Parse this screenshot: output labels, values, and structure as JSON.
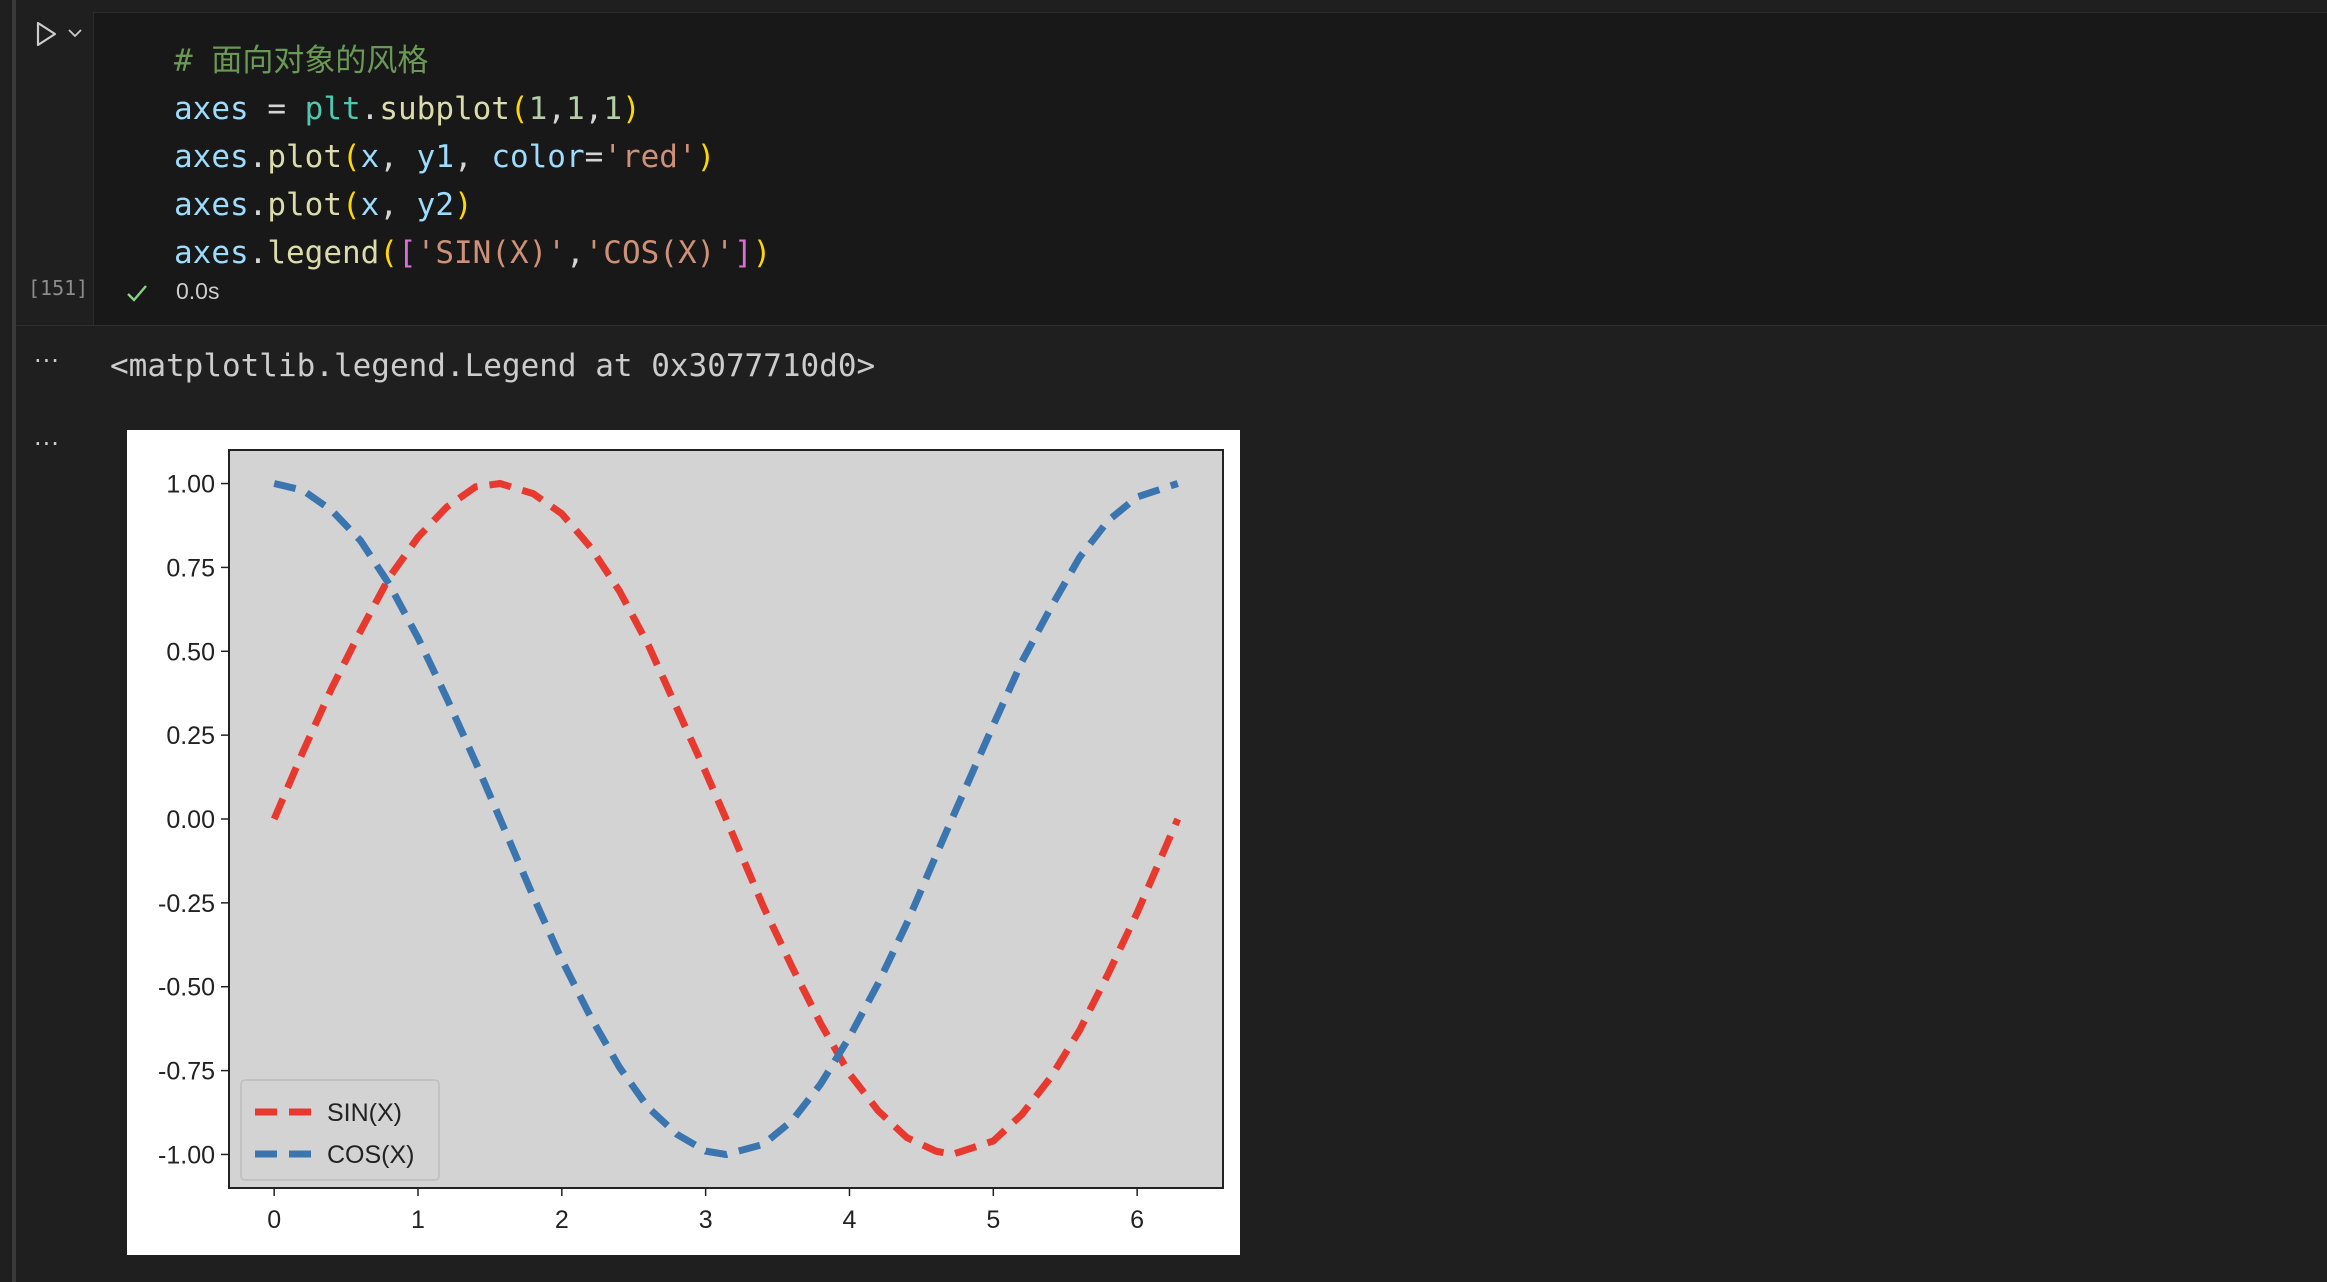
{
  "cell": {
    "execution_count": "[151]",
    "status_time": "0.0s",
    "code_lines": [
      [
        {
          "t": "# 面向对象的风格",
          "c": "comment"
        }
      ],
      [
        {
          "t": "axes",
          "c": "var"
        },
        {
          "t": " = ",
          "c": "plain"
        },
        {
          "t": "plt",
          "c": "module"
        },
        {
          "t": ".",
          "c": "plain"
        },
        {
          "t": "subplot",
          "c": "func"
        },
        {
          "t": "(",
          "c": "paren1"
        },
        {
          "t": "1",
          "c": "num"
        },
        {
          "t": ",",
          "c": "plain"
        },
        {
          "t": "1",
          "c": "num"
        },
        {
          "t": ",",
          "c": "plain"
        },
        {
          "t": "1",
          "c": "num"
        },
        {
          "t": ")",
          "c": "paren1"
        }
      ],
      [
        {
          "t": "axes",
          "c": "var"
        },
        {
          "t": ".",
          "c": "plain"
        },
        {
          "t": "plot",
          "c": "func"
        },
        {
          "t": "(",
          "c": "paren1"
        },
        {
          "t": "x",
          "c": "var"
        },
        {
          "t": ", ",
          "c": "plain"
        },
        {
          "t": "y1",
          "c": "var"
        },
        {
          "t": ", ",
          "c": "plain"
        },
        {
          "t": "color",
          "c": "var"
        },
        {
          "t": "=",
          "c": "plain"
        },
        {
          "t": "'red'",
          "c": "str"
        },
        {
          "t": ")",
          "c": "paren1"
        }
      ],
      [
        {
          "t": "axes",
          "c": "var"
        },
        {
          "t": ".",
          "c": "plain"
        },
        {
          "t": "plot",
          "c": "func"
        },
        {
          "t": "(",
          "c": "paren1"
        },
        {
          "t": "x",
          "c": "var"
        },
        {
          "t": ", ",
          "c": "plain"
        },
        {
          "t": "y2",
          "c": "var"
        },
        {
          "t": ")",
          "c": "paren1"
        }
      ],
      [
        {
          "t": "axes",
          "c": "var"
        },
        {
          "t": ".",
          "c": "plain"
        },
        {
          "t": "legend",
          "c": "func"
        },
        {
          "t": "(",
          "c": "paren1"
        },
        {
          "t": "[",
          "c": "paren2"
        },
        {
          "t": "'SIN(X)'",
          "c": "str"
        },
        {
          "t": ",",
          "c": "plain"
        },
        {
          "t": "'COS(X)'",
          "c": "str"
        },
        {
          "t": "]",
          "c": "paren2"
        },
        {
          "t": ")",
          "c": "paren1"
        }
      ]
    ]
  },
  "output": {
    "gutter_1": "···",
    "gutter_2": "···",
    "text": "<matplotlib.legend.Legend at 0x3077710d0>"
  },
  "colors": {
    "sin": "#e8392f",
    "cos": "#3b75af",
    "axes_bg": "#d3d3d3"
  },
  "chart_data": {
    "type": "line",
    "title": "",
    "xlabel": "",
    "ylabel": "",
    "xlim": [
      -0.314,
      6.597
    ],
    "ylim": [
      -1.1,
      1.1
    ],
    "x_ticks": [
      0,
      1,
      2,
      3,
      4,
      5,
      6
    ],
    "x_tick_labels": [
      "0",
      "1",
      "2",
      "3",
      "4",
      "5",
      "6"
    ],
    "y_ticks": [
      1.0,
      0.75,
      0.5,
      0.25,
      0.0,
      -0.25,
      -0.5,
      -0.75,
      -1.0
    ],
    "y_tick_labels": [
      "1.00",
      "0.75",
      "0.50",
      "0.25",
      "0.00",
      "-0.25",
      "-0.50",
      "-0.75",
      "-1.00"
    ],
    "grid": false,
    "legend_position": "lower-left",
    "line_style": "dashed",
    "series": [
      {
        "name": "SIN(X)",
        "color": "#e8392f",
        "x": [
          0,
          0.2,
          0.4,
          0.6,
          0.8,
          1.0,
          1.2,
          1.4,
          1.571,
          1.8,
          2.0,
          2.2,
          2.4,
          2.6,
          2.8,
          3.0,
          3.142,
          3.4,
          3.6,
          3.8,
          4.0,
          4.2,
          4.4,
          4.6,
          4.712,
          5.0,
          5.2,
          5.4,
          5.6,
          5.8,
          6.0,
          6.283
        ],
        "y": [
          0,
          0.2,
          0.39,
          0.56,
          0.72,
          0.84,
          0.93,
          0.99,
          1.0,
          0.97,
          0.91,
          0.81,
          0.68,
          0.52,
          0.33,
          0.14,
          0,
          -0.26,
          -0.44,
          -0.61,
          -0.76,
          -0.87,
          -0.95,
          -0.99,
          -1.0,
          -0.96,
          -0.88,
          -0.77,
          -0.63,
          -0.46,
          -0.28,
          0
        ]
      },
      {
        "name": "COS(X)",
        "color": "#3b75af",
        "x": [
          0,
          0.2,
          0.4,
          0.6,
          0.8,
          1.0,
          1.2,
          1.4,
          1.571,
          1.8,
          2.0,
          2.2,
          2.4,
          2.6,
          2.8,
          3.0,
          3.142,
          3.4,
          3.6,
          3.8,
          4.0,
          4.2,
          4.4,
          4.6,
          4.712,
          5.0,
          5.2,
          5.4,
          5.6,
          5.8,
          6.0,
          6.283
        ],
        "y": [
          1.0,
          0.98,
          0.92,
          0.83,
          0.7,
          0.54,
          0.36,
          0.17,
          0,
          -0.23,
          -0.42,
          -0.59,
          -0.74,
          -0.86,
          -0.94,
          -0.99,
          -1.0,
          -0.97,
          -0.9,
          -0.79,
          -0.65,
          -0.49,
          -0.31,
          -0.11,
          0,
          0.28,
          0.47,
          0.63,
          0.78,
          0.89,
          0.96,
          1.0
        ]
      }
    ]
  }
}
